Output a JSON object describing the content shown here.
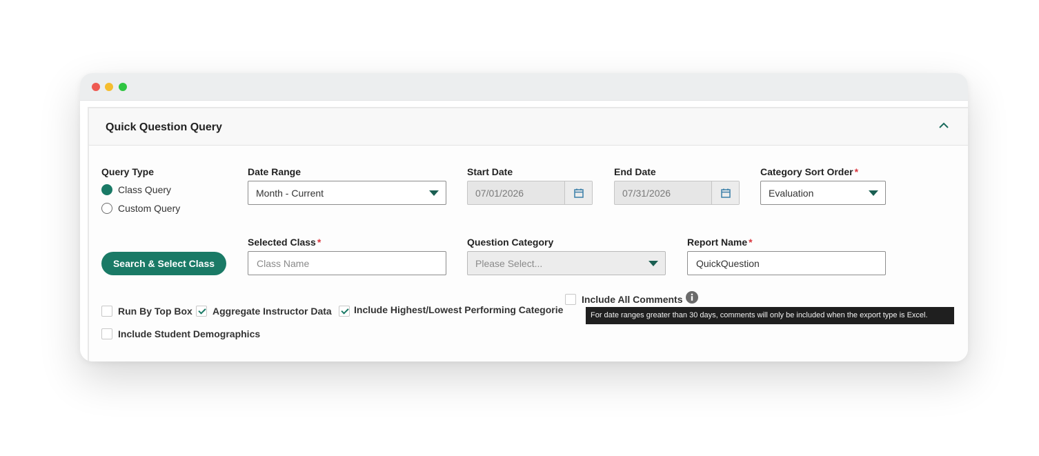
{
  "panel": {
    "title": "Quick Question Query"
  },
  "query_type": {
    "label": "Query Type",
    "options": [
      {
        "label": "Class Query",
        "selected": true
      },
      {
        "label": "Custom Query",
        "selected": false
      }
    ]
  },
  "date_range": {
    "label": "Date Range",
    "value": "Month - Current"
  },
  "start_date": {
    "label": "Start Date",
    "value": "07/01/2026"
  },
  "end_date": {
    "label": "End Date",
    "value": "07/31/2026"
  },
  "category_sort_order": {
    "label": "Category Sort Order",
    "required_mark": "*",
    "value": "Evaluation"
  },
  "search_button": {
    "label": "Search & Select Class"
  },
  "selected_class": {
    "label": "Selected Class",
    "required_mark": "*",
    "placeholder": "Class Name",
    "value": ""
  },
  "question_category": {
    "label": "Question Category",
    "value": "Please Select..."
  },
  "report_name": {
    "label": "Report Name",
    "required_mark": "*",
    "value": "QuickQuestion"
  },
  "options": {
    "run_by_top_box": {
      "label": "Run By Top Box",
      "checked": false
    },
    "aggregate_instructor": {
      "label": "Aggregate Instructor Data",
      "checked": true
    },
    "include_highest_lowest": {
      "label": "Include Highest/Lowest Performing Categories",
      "checked": true
    },
    "include_all_comments": {
      "label": "Include All Comments",
      "checked": false
    },
    "include_demographics": {
      "label": "Include Student Demographics",
      "checked": false
    }
  },
  "tooltip": {
    "text": "For date ranges greater than 30 days, comments will only be included when the export type is Excel."
  },
  "colors": {
    "accent": "#1a7a66",
    "required": "#d9363e"
  },
  "icons": {
    "collapse": "chevron-up-icon",
    "calendar": "calendar-icon",
    "info": "info-icon"
  }
}
